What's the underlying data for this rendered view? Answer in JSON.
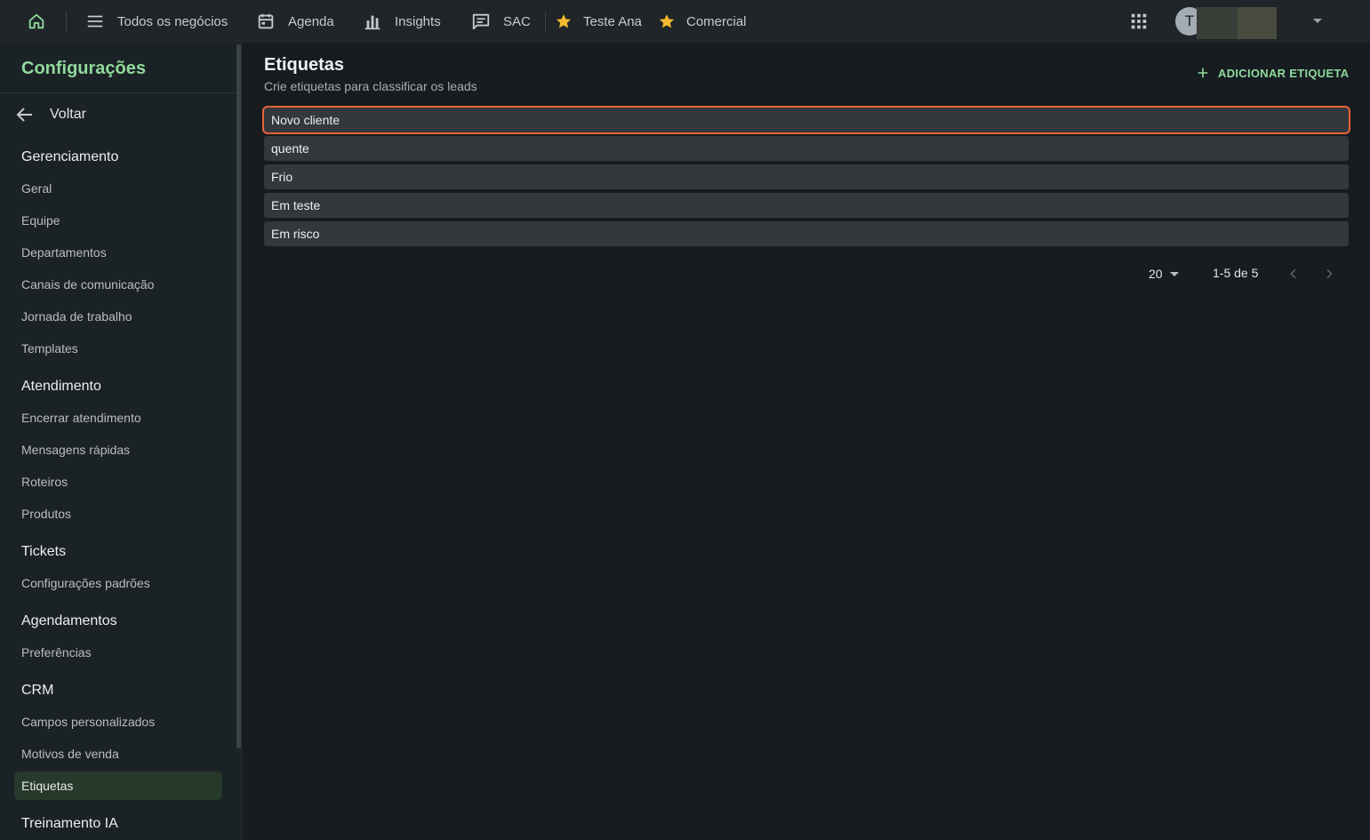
{
  "topbar": {
    "items": [
      {
        "label": "Todos os negócios",
        "icon": "menu-icon"
      },
      {
        "label": "Agenda",
        "icon": "calendar-icon"
      },
      {
        "label": "Insights",
        "icon": "bar-chart-icon"
      },
      {
        "label": "SAC",
        "icon": "chat-icon"
      }
    ],
    "favorites": [
      {
        "label": "Teste Ana",
        "icon": "star-icon"
      },
      {
        "label": "Comercial",
        "icon": "star-icon"
      }
    ],
    "avatar_initial": "T"
  },
  "sidebar": {
    "title": "Configurações",
    "back_label": "Voltar",
    "sections": [
      {
        "title": "Gerenciamento",
        "items": [
          "Geral",
          "Equipe",
          "Departamentos",
          "Canais de comunicação",
          "Jornada de trabalho",
          "Templates"
        ]
      },
      {
        "title": "Atendimento",
        "items": [
          "Encerrar atendimento",
          "Mensagens rápidas",
          "Roteiros",
          "Produtos"
        ]
      },
      {
        "title": "Tickets",
        "items": [
          "Configurações padrões"
        ]
      },
      {
        "title": "Agendamentos",
        "items": [
          "Preferências"
        ]
      },
      {
        "title": "CRM",
        "items": [
          "Campos personalizados",
          "Motivos de venda",
          "Etiquetas"
        ]
      },
      {
        "title": "Treinamento IA",
        "items": []
      }
    ],
    "active_item": "Etiquetas"
  },
  "main": {
    "title": "Etiquetas",
    "subtitle": "Crie etiquetas para classificar os leads",
    "add_button_label": "ADICIONAR ETIQUETA",
    "tags": [
      "Novo cliente",
      "quente",
      "Frio",
      "Em teste",
      "Em risco"
    ],
    "selected_tag": "Novo cliente",
    "pagination": {
      "page_size": "20",
      "range_label": "1-5 de 5"
    }
  },
  "colors": {
    "accent": "#8fd99b",
    "selection_border": "#e8643c",
    "star": "#f5b82e",
    "background": "#161c20"
  }
}
